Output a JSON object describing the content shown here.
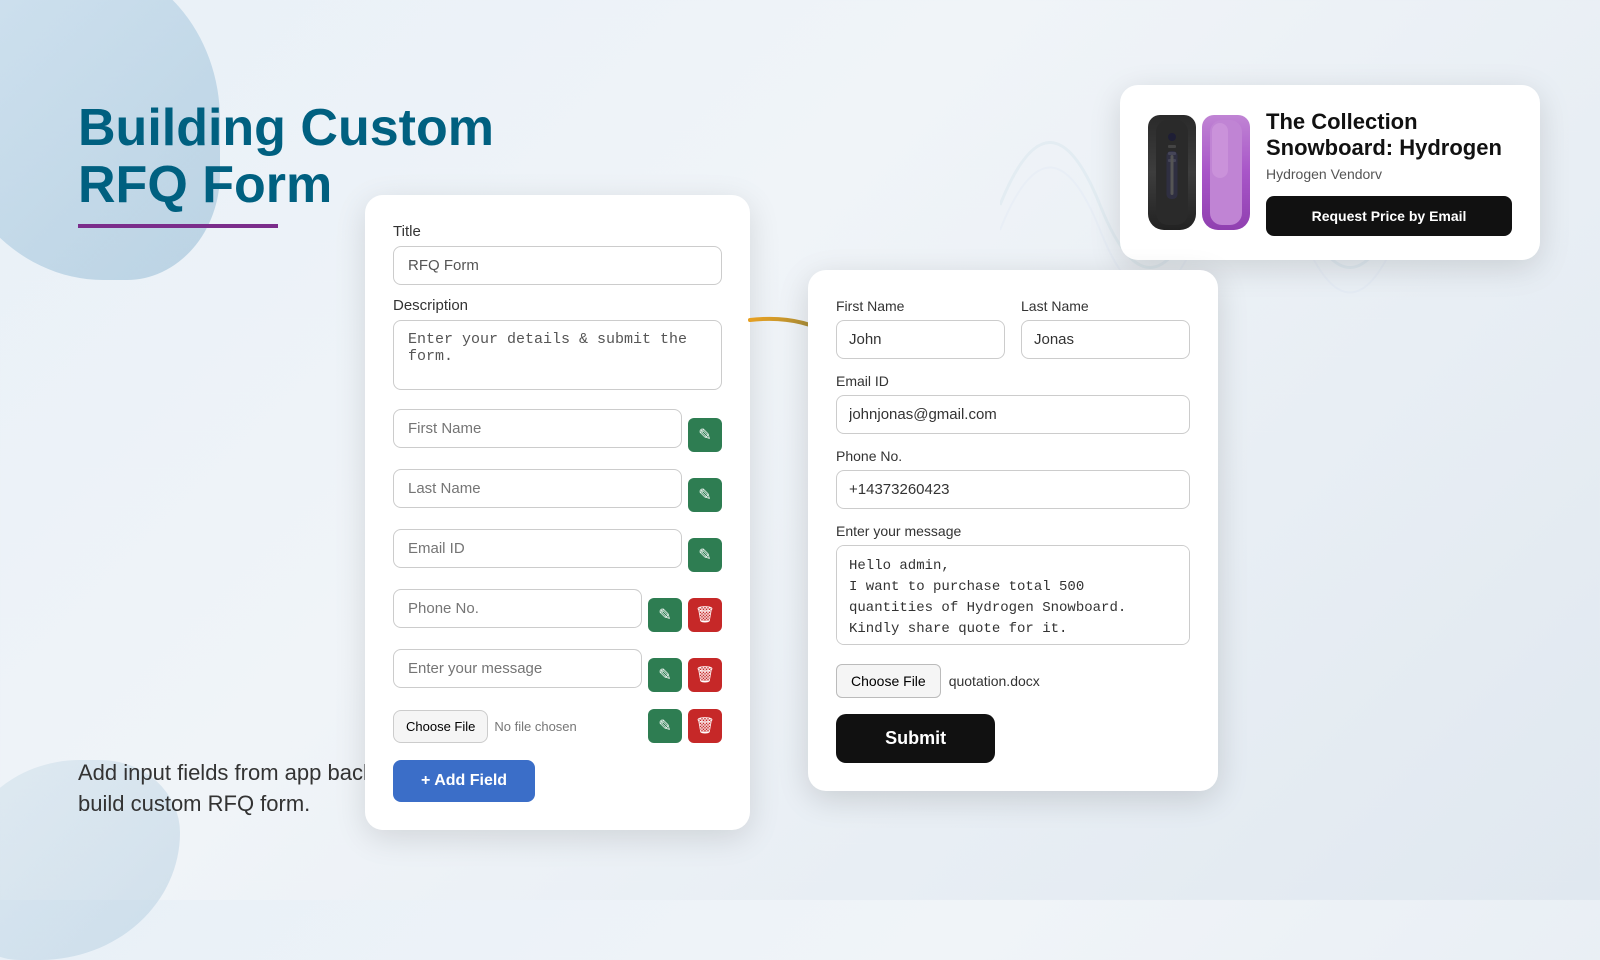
{
  "page": {
    "heading_line1": "Building Custom",
    "heading_line2": "RFQ Form",
    "subtext": "Add input fields from app backend & build custom RFQ form."
  },
  "form_builder": {
    "title_label": "Title",
    "title_value": "RFQ Form",
    "description_label": "Description",
    "description_placeholder": "Enter your details & submit the form.",
    "fields": [
      {
        "label": "First Name",
        "has_edit": true,
        "has_delete": false
      },
      {
        "label": "Last Name",
        "has_edit": true,
        "has_delete": false
      },
      {
        "label": "Email ID",
        "has_edit": true,
        "has_delete": false
      },
      {
        "label": "Phone No.",
        "has_edit": true,
        "has_delete": true
      },
      {
        "label": "Enter your message",
        "has_edit": true,
        "has_delete": true
      }
    ],
    "file_label": "Choose File",
    "file_no_chosen": "No file chosen",
    "add_field_label": "+ Add Field"
  },
  "product_card": {
    "title": "The Collection Snowboard: Hydrogen",
    "vendor": "Hydrogen Vendorv",
    "request_button": "Request Price by Email"
  },
  "rfq_form": {
    "first_name_label": "First Name",
    "first_name_value": "John",
    "last_name_label": "Last Name",
    "last_name_value": "Jonas",
    "email_label": "Email ID",
    "email_value": "johnjonas@gmail.com",
    "phone_label": "Phone No.",
    "phone_value": "+14373260423",
    "message_label": "Enter your message",
    "message_value": "Hello admin,\nI want to purchase total 500\nquantities of Hydrogen Snowboard.\nKindly share quote for it.",
    "file_label": "Choose File",
    "file_name": "quotation.docx",
    "submit_label": "Submit"
  },
  "icons": {
    "edit": "✎",
    "delete": "🗑",
    "pencil": "✏"
  }
}
